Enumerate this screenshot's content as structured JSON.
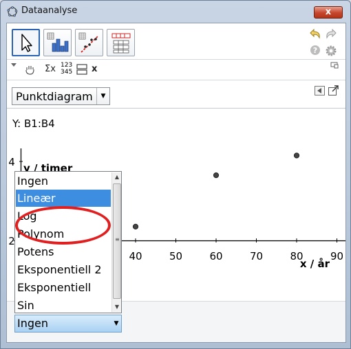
{
  "window": {
    "title": "Dataanalyse",
    "close_label": "x"
  },
  "stylebar": {
    "sigma_label": "Σx",
    "numbers_top": "123",
    "numbers_bottom": "345",
    "x_label": "x"
  },
  "chart_type": {
    "selected": "Punktdiagram"
  },
  "y_range": "Y:  B1:B4",
  "chart_data": {
    "type": "scatter",
    "xlabel": "x / år",
    "ylabel": "y / timer",
    "x_ticks_visible": [
      "40",
      "50",
      "60",
      "70",
      "80",
      "90"
    ],
    "y_ticks_visible": [
      "4",
      "2"
    ],
    "points": [
      {
        "x": 40,
        "y": 2.35
      },
      {
        "x": 60,
        "y": 3.65
      },
      {
        "x": 80,
        "y": 4.15
      }
    ]
  },
  "regression": {
    "options": [
      "Ingen",
      "Lineær",
      "Log",
      "Polynom",
      "Potens",
      "Eksponentiell 2",
      "Eksponentiell",
      "Sin"
    ],
    "highlighted_index": 1,
    "selected": "Ingen"
  },
  "colors": {
    "highlight_ring": "#e02020",
    "selection": "#3d8ee0"
  }
}
